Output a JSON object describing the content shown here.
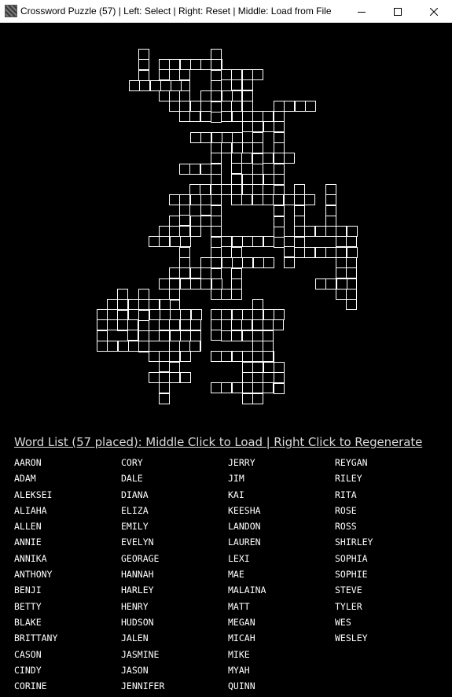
{
  "window": {
    "title": "Crossword Puzzle (57) | Left: Select | Right: Reset | Middle: Load from File",
    "minimize_glyph": "—",
    "maximize_glyph": "☐",
    "close_glyph": "✕"
  },
  "word_list": {
    "header": "Word List (57 placed): Middle Click to Load | Right Click to Regenerate",
    "columns": [
      [
        "AARON",
        "ADAM",
        "ALEKSEI",
        "ALIAHA",
        "ALLEN",
        "ANNIE",
        "ANNIKA",
        "ANTHONY",
        "BENJI",
        "BETTY",
        "BLAKE",
        "BRITTANY",
        "CASON",
        "CINDY",
        "CORINE"
      ],
      [
        "CORY",
        "DALE",
        "DIANA",
        "ELIZA",
        "EMILY",
        "EVELYN",
        "GEORAGE",
        "HANNAH",
        "HARLEY",
        "HENRY",
        "HUDSON",
        "JALEN",
        "JASMINE",
        "JASON",
        "JENNIFER"
      ],
      [
        "JERRY",
        "JIM",
        "KAI",
        "KEESHA",
        "LANDON",
        "LAUREN",
        "LEXI",
        "MAE",
        "MALAINA",
        "MATT",
        "MEGAN",
        "MICAH",
        "MIKE",
        "MYAH",
        "QUINN"
      ],
      [
        "REYGAN",
        "RILEY",
        "RITA",
        "ROSE",
        "ROSS",
        "SHIRLEY",
        "SOPHIA",
        "SOPHIE",
        "STEVE",
        "TYLER",
        "WES",
        "WESLEY"
      ]
    ]
  },
  "colors": {
    "background": "#000000",
    "cell_border": "#ffffff",
    "text": "#ffffff",
    "titlebar": "#ffffff"
  }
}
